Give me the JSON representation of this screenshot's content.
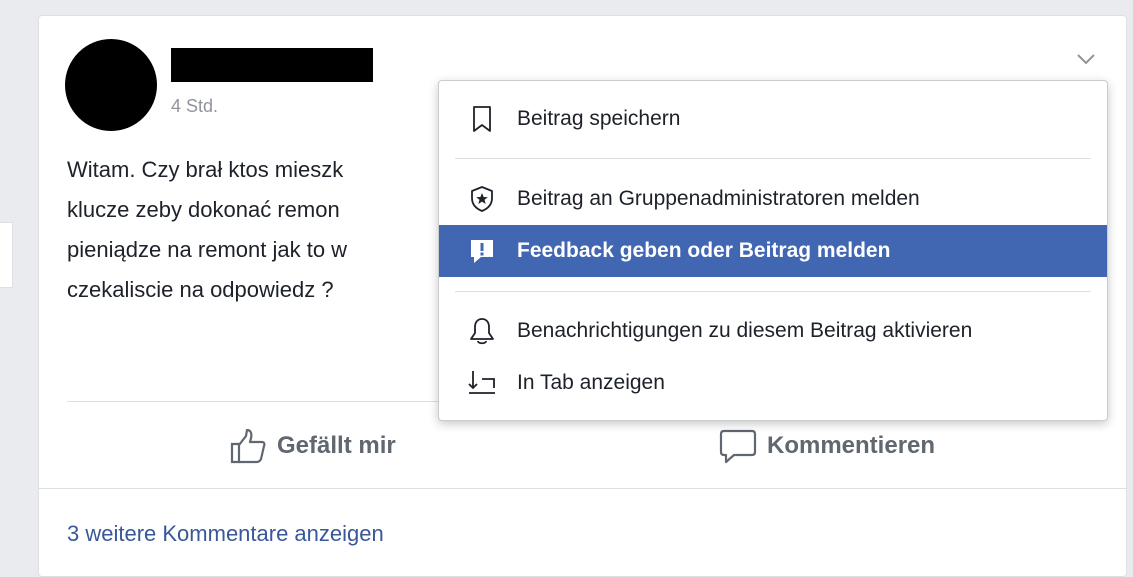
{
  "post": {
    "timestamp": "4 Std.",
    "text_lines": [
      "Witam. Czy brał ktos mieszk",
      "klucze zeby dokonać remon",
      "pieniądze na remont jak to w",
      "czekaliscie na odpowiedz ?"
    ],
    "actions": {
      "like_label": "Gefällt mir",
      "comment_label": "Kommentieren"
    },
    "more_comments_label": "3 weitere Kommentare anzeigen"
  },
  "menu": {
    "items": [
      {
        "label": "Beitrag speichern",
        "icon": "bookmark-icon"
      },
      {
        "label": "Beitrag an Gruppenadministratoren melden",
        "icon": "shield-star-icon"
      },
      {
        "label": "Feedback geben oder Beitrag melden",
        "icon": "exclamation-icon",
        "highlighted": true
      },
      {
        "label": "Benachrichtigungen zu diesem Beitrag aktivieren",
        "icon": "bell-icon"
      },
      {
        "label": "In Tab anzeigen",
        "icon": "open-in-tab-icon"
      }
    ]
  },
  "colors": {
    "highlight": "#4267b2",
    "link": "#385898",
    "background": "#e9ebee"
  }
}
